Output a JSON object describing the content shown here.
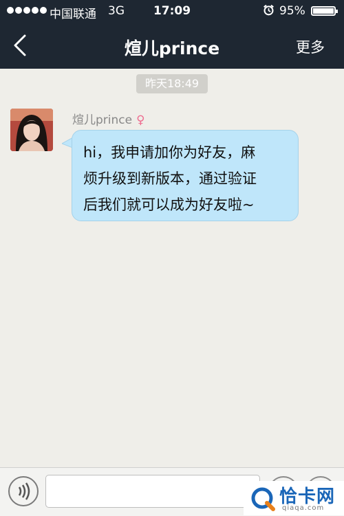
{
  "status_bar": {
    "carrier": "中国联通",
    "network": "3G",
    "time": "17:09",
    "battery": "95%"
  },
  "nav": {
    "title": "煊儿prince",
    "more": "更多"
  },
  "chat": {
    "timestamp": "昨天18:49",
    "messages": [
      {
        "sender": "煊儿prince",
        "gender": "♀",
        "lines": [
          "hi，我申请加你为好友，麻",
          "烦升级到新版本，通过验证",
          "后我们就可以成为好友啦~"
        ]
      }
    ]
  },
  "input": {
    "value": ""
  },
  "watermark": {
    "name": "恰卡网",
    "url": "qiaqa.com"
  },
  "colors": {
    "navbar": "#1e2732",
    "bubble": "#bfe6fa",
    "background": "#efeee9",
    "gender": "#ee6d90"
  }
}
